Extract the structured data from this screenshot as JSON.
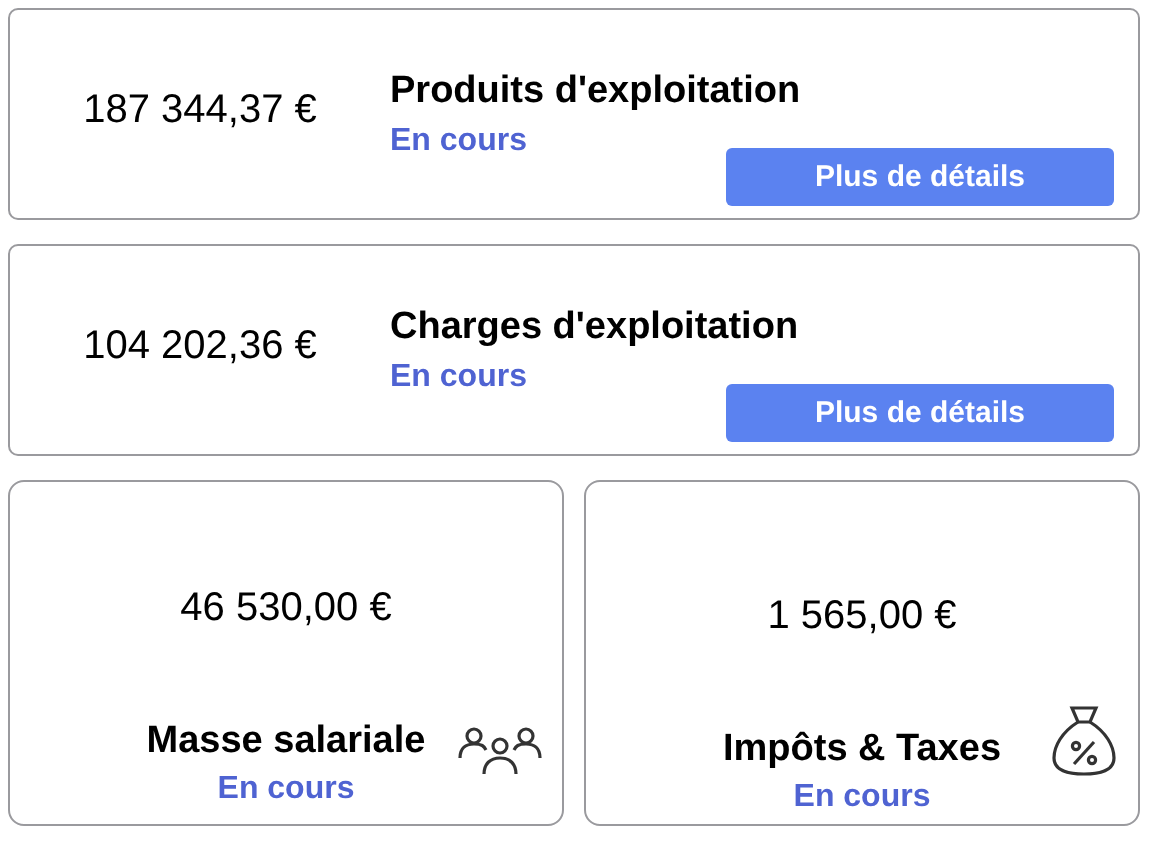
{
  "wide_cards": [
    {
      "amount": "187 344,37 €",
      "title": "Produits d'exploitation",
      "status": "En cours",
      "button": "Plus de détails"
    },
    {
      "amount": "104 202,36 €",
      "title": "Charges d'exploitation",
      "status": "En cours",
      "button": "Plus de détails"
    }
  ],
  "small_cards": [
    {
      "amount": "46 530,00 €",
      "title": "Masse salariale",
      "status": "En cours",
      "kind": "people"
    },
    {
      "amount": "1 565,00 €",
      "title": "Impôts & Taxes",
      "status": "En cours",
      "kind": "money-bag"
    }
  ]
}
